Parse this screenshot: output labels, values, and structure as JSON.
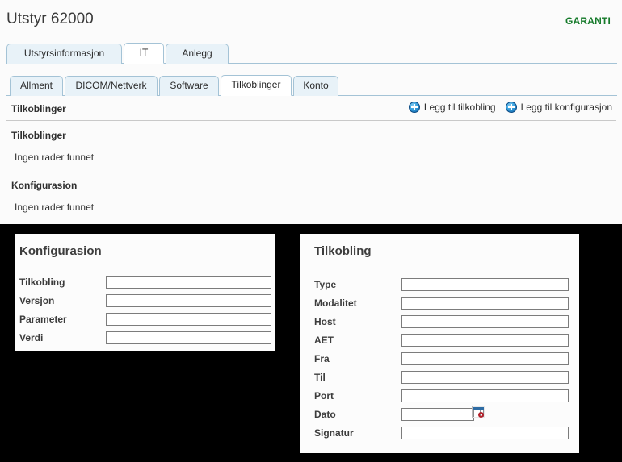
{
  "header": {
    "title": "Utstyr 62000",
    "warranty_badge": "GARANTI"
  },
  "tabs_primary": [
    {
      "label": "Utstyrsinformasjon",
      "active": false
    },
    {
      "label": "IT",
      "active": true
    },
    {
      "label": "Anlegg",
      "active": false
    }
  ],
  "tabs_secondary": [
    {
      "label": "Allment",
      "active": false
    },
    {
      "label": "DICOM/Nettverk",
      "active": false
    },
    {
      "label": "Software",
      "active": false
    },
    {
      "label": "Tilkoblinger",
      "active": true
    },
    {
      "label": "Konto",
      "active": false
    }
  ],
  "toolbar": {
    "title": "Tilkoblinger",
    "actions": [
      {
        "label": "Legg til tilkobling",
        "icon": "plus-circle-icon"
      },
      {
        "label": "Legg til konfigurasjon",
        "icon": "plus-circle-icon"
      }
    ]
  },
  "sections": [
    {
      "title": "Tilkoblinger",
      "empty_text": "Ingen rader funnet"
    },
    {
      "title": "Konfigurasion",
      "empty_text": "Ingen rader funnet"
    }
  ],
  "panel_konfigurasion": {
    "heading": "Konfigurasion",
    "fields": [
      {
        "label": "Tilkobling",
        "value": "",
        "placeholder": ""
      },
      {
        "label": "Versjon",
        "value": "",
        "placeholder": ""
      },
      {
        "label": "Parameter",
        "value": "",
        "placeholder": ""
      },
      {
        "label": "Verdi",
        "value": "",
        "placeholder": ""
      }
    ]
  },
  "panel_tilkobling": {
    "heading": "Tilkobling",
    "fields": [
      {
        "label": "Type",
        "value": "",
        "placeholder": ""
      },
      {
        "label": "Modalitet",
        "value": "",
        "placeholder": ""
      },
      {
        "label": "Host",
        "value": "",
        "placeholder": ""
      },
      {
        "label": "AET",
        "value": "",
        "placeholder": ""
      },
      {
        "label": "Fra",
        "value": "",
        "placeholder": ""
      },
      {
        "label": "Til",
        "value": "",
        "placeholder": ""
      },
      {
        "label": "Port",
        "value": "",
        "placeholder": ""
      },
      {
        "label": "Dato",
        "value": "",
        "placeholder": "",
        "icon": "calendar-icon"
      },
      {
        "label": "Signatur",
        "value": "",
        "placeholder": ""
      }
    ]
  },
  "colors": {
    "accent_blue": "#37a0dd",
    "tab_border": "#a4c3d6",
    "tab_inactive_bg": "#e8f2f8",
    "warranty_green": "#157a2a",
    "panel_bg": "#fcfcfc",
    "backdrop": "#000000"
  }
}
